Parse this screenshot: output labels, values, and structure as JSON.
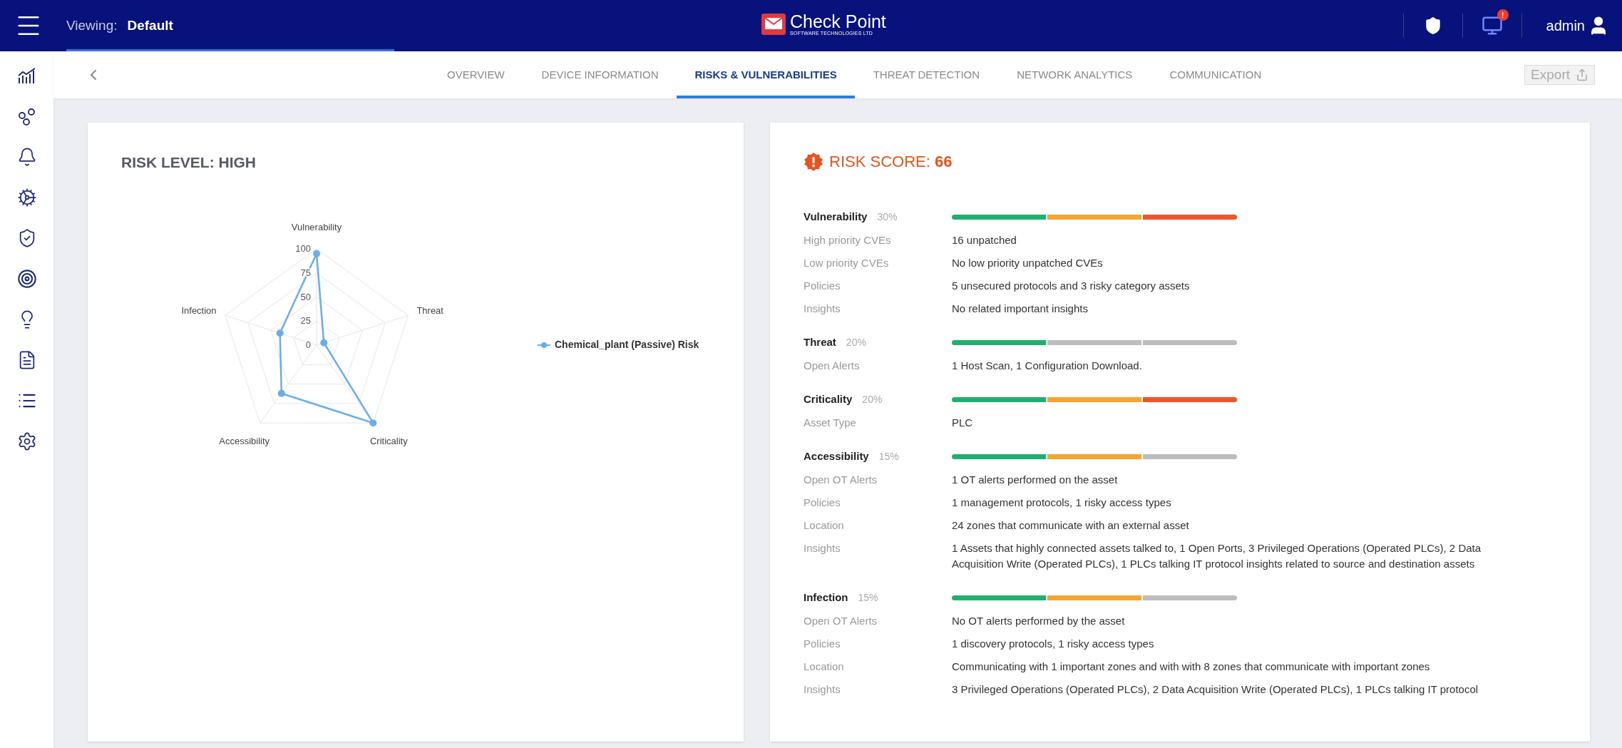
{
  "header": {
    "viewing_label": "Viewing:",
    "viewing_value": "Default",
    "logo_name": "Check Point",
    "logo_sub": "SOFTWARE TECHNOLOGIES LTD",
    "alert_badge": "!",
    "user": "admin"
  },
  "tabs": [
    {
      "label": "OVERVIEW",
      "selected": false
    },
    {
      "label": "DEVICE INFORMATION",
      "selected": false
    },
    {
      "label": "RISKS & VULNERABILITIES",
      "selected": true
    },
    {
      "label": "THREAT DETECTION",
      "selected": false
    },
    {
      "label": "NETWORK ANALYTICS",
      "selected": false
    },
    {
      "label": "COMMUNICATION",
      "selected": false
    }
  ],
  "export_button": {
    "label": "Export",
    "disabled": true
  },
  "risk_level": {
    "title": "RISK LEVEL: HIGH",
    "radar": {
      "ticks": [
        "100",
        "75",
        "50",
        "25",
        "0"
      ],
      "legend": "Chemical_plant (Passive) Risk",
      "axes": [
        "Vulnerability",
        "Threat",
        "Criticality",
        "Accessibility",
        "Infection"
      ]
    }
  },
  "risk_score": {
    "label": "RISK SCORE:",
    "value": "66",
    "categories": [
      {
        "name": "Vulnerability",
        "weight": "30%",
        "segments": [
          {
            "color": "#1db06e"
          },
          {
            "color": "#f7a531"
          },
          {
            "color": "#f0542a"
          }
        ],
        "rows": [
          {
            "label": "High priority CVEs",
            "value": "16 unpatched"
          },
          {
            "label": "Low priority CVEs",
            "value": "No low priority unpatched CVEs"
          },
          {
            "label": "Policies",
            "value": "5 unsecured protocols and 3 risky category assets"
          },
          {
            "label": "Insights",
            "value": "No related important insights"
          }
        ]
      },
      {
        "name": "Threat",
        "weight": "20%",
        "segments": [
          {
            "color": "#1db06e"
          },
          {
            "color": "#bdbdbd"
          },
          {
            "color": "#bdbdbd"
          }
        ],
        "rows": [
          {
            "label": "Open Alerts",
            "value": "1 Host Scan, 1 Configuration Download."
          }
        ]
      },
      {
        "name": "Criticality",
        "weight": "20%",
        "segments": [
          {
            "color": "#1db06e"
          },
          {
            "color": "#f7a531"
          },
          {
            "color": "#f0542a"
          }
        ],
        "rows": [
          {
            "label": "Asset Type",
            "value": "PLC"
          }
        ]
      },
      {
        "name": "Accessibility",
        "weight": "15%",
        "segments": [
          {
            "color": "#1db06e"
          },
          {
            "color": "#f7a531"
          },
          {
            "color": "#bdbdbd"
          }
        ],
        "rows": [
          {
            "label": "Open OT Alerts",
            "value": "1 OT alerts performed on the asset"
          },
          {
            "label": "Policies",
            "value": "1 management protocols, 1 risky access types"
          },
          {
            "label": "Location",
            "value": "24 zones that communicate with an external asset"
          },
          {
            "label": "Insights",
            "value": "1 Assets that highly connected assets talked to, 1 Open Ports, 3 Privileged Operations (Operated PLCs), 2 Data Acquisition Write (Operated PLCs), 1 PLCs talking IT protocol insights related to source and destination assets"
          }
        ]
      },
      {
        "name": "Infection",
        "weight": "15%",
        "segments": [
          {
            "color": "#1db06e"
          },
          {
            "color": "#f7a531"
          },
          {
            "color": "#bdbdbd"
          }
        ],
        "rows": [
          {
            "label": "Open OT Alerts",
            "value": "No OT alerts performed by the asset"
          },
          {
            "label": "Policies",
            "value": "1 discovery protocols, 1 risky access types"
          },
          {
            "label": "Location",
            "value": "Communicating with 1 important zones and with with 8 zones that communicate with important zones"
          },
          {
            "label": "Insights",
            "value": "3 Privileged Operations (Operated PLCs), 2 Data Acquisition Write (Operated PLCs), 1 PLCs talking IT protocol"
          }
        ]
      }
    ]
  }
}
